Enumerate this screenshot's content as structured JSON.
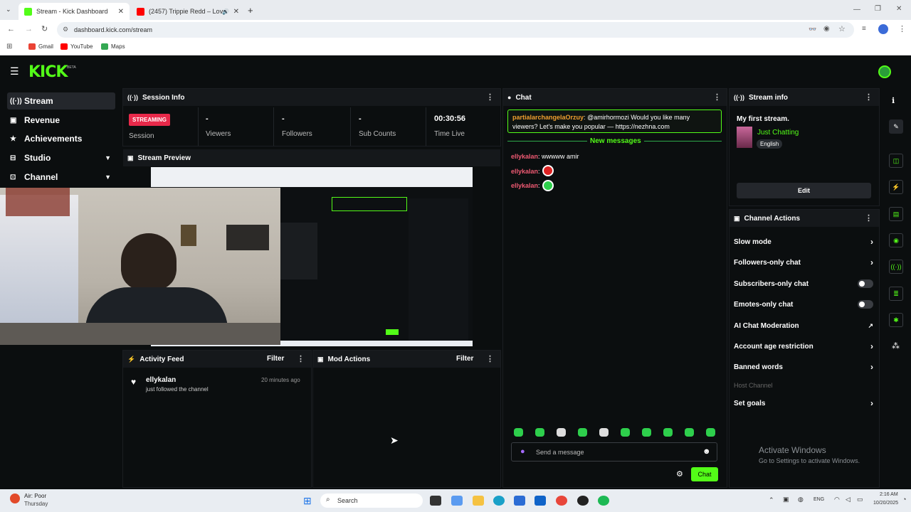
{
  "browser": {
    "tabs": [
      {
        "title": "Stream - Kick Dashboard"
      },
      {
        "title": "(2457) Trippie Redd – Love"
      }
    ],
    "url": "dashboard.kick.com/stream",
    "bookmarks": [
      {
        "label": "Gmail"
      },
      {
        "label": "YouTube"
      },
      {
        "label": "Maps"
      }
    ]
  },
  "app": {
    "logo": "KICK",
    "logo_badge": "BETA"
  },
  "sidebar": {
    "items": [
      {
        "label": "Stream",
        "icon": "broadcast-icon"
      },
      {
        "label": "Revenue",
        "icon": "revenue-icon"
      },
      {
        "label": "Achievements",
        "icon": "trophy-icon"
      },
      {
        "label": "Studio",
        "icon": "studio-icon"
      },
      {
        "label": "Channel",
        "icon": "channel-icon"
      }
    ]
  },
  "session_info": {
    "title": "Session Info",
    "status_badge": "STREAMING",
    "status_label": "Session",
    "stats": [
      {
        "value": "-",
        "label": "Viewers"
      },
      {
        "value": "-",
        "label": "Followers"
      },
      {
        "value": "-",
        "label": "Sub Counts"
      },
      {
        "value": "00:30:56",
        "label": "Time Live"
      }
    ]
  },
  "stream_preview": {
    "title": "Stream Preview"
  },
  "activity_feed": {
    "title": "Activity Feed",
    "filter": "Filter",
    "items": [
      {
        "user": "ellykalan",
        "action": "just followed the channel",
        "time": "20 minutes ago"
      }
    ]
  },
  "mod_actions": {
    "title": "Mod Actions",
    "filter": "Filter"
  },
  "chat": {
    "title": "Chat",
    "pinned": {
      "user": "partialarchangelaOrzuy",
      "text": "@amirhormozi Would you like many viewers? Let's make you popular — https://nezhna.com"
    },
    "new_messages": "New messages",
    "messages": [
      {
        "user": "ellykalan",
        "text": "wwwww amir"
      },
      {
        "user": "ellykalan",
        "text": ""
      },
      {
        "user": "ellykalan",
        "text": ""
      }
    ],
    "input_placeholder": "Send a message",
    "send_label": "Chat"
  },
  "stream_info": {
    "title": "Stream info",
    "stream_title": "My first stream.",
    "category": "Just Chatting",
    "language": "English",
    "edit_label": "Edit"
  },
  "channel_actions": {
    "title": "Channel Actions",
    "items": [
      {
        "label": "Slow mode",
        "control": "chevron"
      },
      {
        "label": "Followers-only chat",
        "control": "chevron"
      },
      {
        "label": "Subscribers-only chat",
        "control": "toggle"
      },
      {
        "label": "Emotes-only chat",
        "control": "toggle"
      },
      {
        "label": "AI Chat Moderation",
        "control": "external"
      },
      {
        "label": "Account age restriction",
        "control": "chevron"
      },
      {
        "label": "Banned words",
        "control": "chevron"
      },
      {
        "label": "Host Channel",
        "control": "none"
      },
      {
        "label": "Set goals",
        "control": "chevron"
      }
    ]
  },
  "watermark": {
    "line1": "Activate Windows",
    "line2": "Go to Settings to activate Windows."
  },
  "taskbar": {
    "weather_title": "Air: Poor",
    "weather_sub": "Thursday",
    "search": "Search",
    "lang": "ENG",
    "time": "2:16 AM",
    "date": "10/20/2025"
  },
  "colors": {
    "accent": "#53fc18",
    "live": "#e8294a",
    "username": "#f05a73",
    "pinned_user": "#f0a030"
  }
}
